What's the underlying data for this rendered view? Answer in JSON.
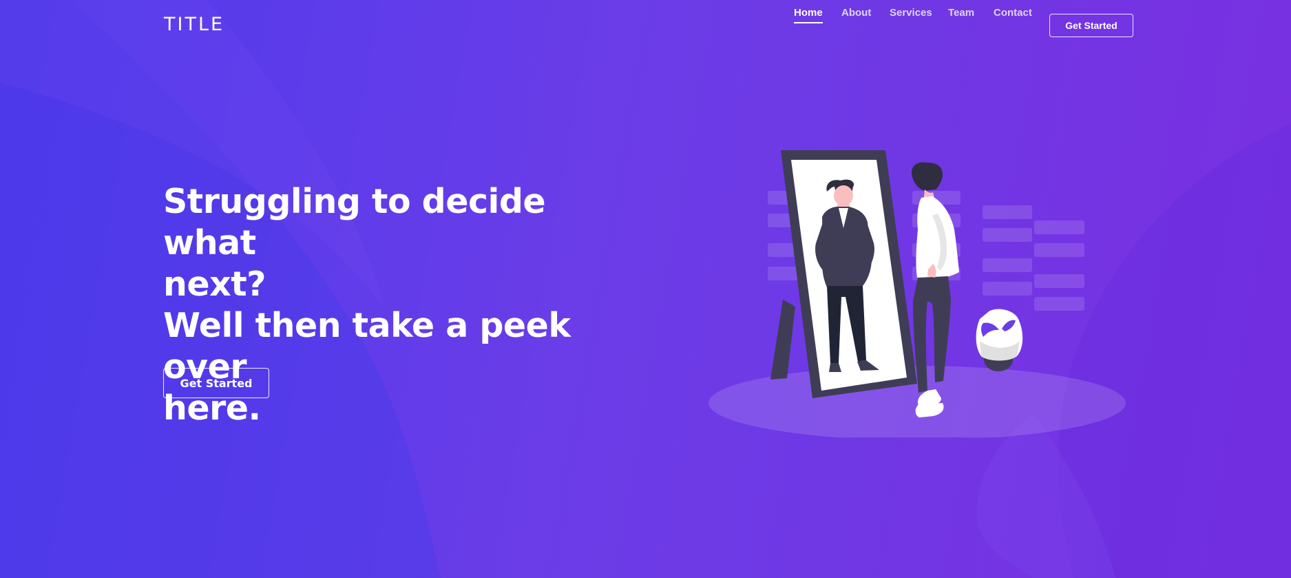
{
  "header": {
    "logo": "TITLE",
    "nav": [
      {
        "label": "Home",
        "active": true
      },
      {
        "label": "About",
        "active": false
      },
      {
        "label": "Services",
        "active": false
      },
      {
        "label": "Team",
        "active": false
      },
      {
        "label": "Contact",
        "active": false
      }
    ],
    "cta_label": "Get Started"
  },
  "hero": {
    "title_lines": [
      "Struggling to decide what",
      "next?",
      "Well then take a peek over",
      "here."
    ],
    "cta_label": "Get Started",
    "illustration_icon": "person-looking-in-mirror-illustration"
  },
  "colors": {
    "bg_start": "#4f3aec",
    "bg_end": "#7a2fe0",
    "accent": "#ffffff"
  }
}
